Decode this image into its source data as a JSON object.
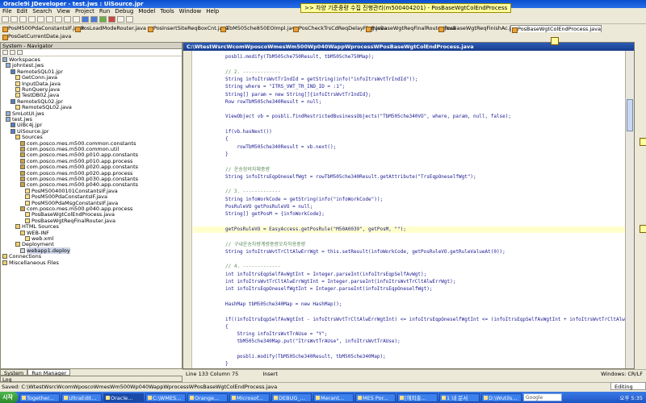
{
  "window": {
    "title": "Oracle9i JDeveloper - test.jws : UiSource.jpr"
  },
  "tooltip": ">> 차양 기준중량 수집 진행관리(m500404201) - PosBaseWgtColEndProcess",
  "menu": [
    "File",
    "Edit",
    "Search",
    "View",
    "Project",
    "Run",
    "Debug",
    "Model",
    "Tools",
    "Window",
    "Help"
  ],
  "file_tabs": {
    "row1": [
      "PosM500PdaConstantsIF.java",
      "PosLoadModeRouter.java",
      "PosInsertSiteReqBoxCnt.java",
      "TbM505che850EOImpl.java",
      "PosCheckTrsCdReqDelayFlag.java",
      "PosBaseWgtReqFinalRouter.java",
      "PosBaseWgtReqFinishAc.java",
      "PosBaseWgtColEndProcess.java"
    ],
    "row2": [
      "PosGetCurrentDate.java"
    ]
  },
  "navigator": {
    "title": "System - Navigator",
    "tree": [
      {
        "label": "Workspaces",
        "icon": "ws"
      },
      {
        "label": "johntest.jws",
        "icon": "ws"
      },
      {
        "label": "RemoteSQL01.jpr",
        "icon": "prj"
      },
      {
        "label": "GetConn.java",
        "icon": "jav"
      },
      {
        "label": "InputData.java",
        "icon": "jav"
      },
      {
        "label": "RunQuery.java",
        "icon": "jav"
      },
      {
        "label": "TestDB02.java",
        "icon": "jav"
      },
      {
        "label": "RemoteSQL02.jpr",
        "icon": "prj"
      },
      {
        "label": "RemoteSQL02.java",
        "icon": "jav"
      },
      {
        "label": "SmLotUI.jws",
        "icon": "ws"
      },
      {
        "label": "test.jws",
        "icon": "ws"
      },
      {
        "label": "UiBc4j.jpr",
        "icon": "prj"
      },
      {
        "label": "UiSource.jpr",
        "icon": "prj"
      },
      {
        "label": "Sources",
        "icon": "fld"
      },
      {
        "label": "com.posco.mes.m500.common.constants",
        "icon": "pkg"
      },
      {
        "label": "com.posco.mes.m500.common.util",
        "icon": "pkg"
      },
      {
        "label": "com.posco.mes.m500.p010.app.constants",
        "icon": "pkg"
      },
      {
        "label": "com.posco.mes.m500.p010.app.process",
        "icon": "pkg"
      },
      {
        "label": "com.posco.mes.m500.p020.app.constants",
        "icon": "pkg"
      },
      {
        "label": "com.posco.mes.m500.p020.app.process",
        "icon": "pkg"
      },
      {
        "label": "com.posco.mes.m500.p030.app.constants",
        "icon": "pkg"
      },
      {
        "label": "com.posco.mes.m500.p040.app.constants",
        "icon": "pkg"
      },
      {
        "label": "PosM500400101ConstantsIF.java",
        "icon": "jav"
      },
      {
        "label": "PosM500PdaConstantsIF.java",
        "icon": "jav"
      },
      {
        "label": "PosM500PdaMsgConstantsIF.java",
        "icon": "jav"
      },
      {
        "label": "com.posco.mes.m500.p040.app.process",
        "icon": "pkg"
      },
      {
        "label": "PosBaseWgtColEndProcess.java",
        "icon": "jav"
      },
      {
        "label": "PosBaseWgtReqFinalRouter.java",
        "icon": "jav"
      },
      {
        "label": "HTML Sources",
        "icon": "fld"
      },
      {
        "label": "WEB-INF",
        "icon": "fld"
      },
      {
        "label": "web.xml",
        "icon": "jav"
      },
      {
        "label": "Deployment",
        "icon": "fld"
      },
      {
        "label": "webapp1.deploy",
        "icon": "jav"
      },
      {
        "label": "Connections",
        "icon": "fld"
      },
      {
        "label": "Miscellaneous Files",
        "icon": "fld"
      }
    ],
    "tabs": [
      "System",
      "Run Manager"
    ],
    "log_label": "Log"
  },
  "editor": {
    "title": "C:\\WtestWsrcWcomWposcoWmesWm500Wp040WappWprocessWPosBaseWgtColEndProcess.java",
    "lines": [
      {
        "t": "posbli.modify(TbM505che750Result, tbM505che750Map);",
        "c": ""
      },
      {
        "t": "",
        "c": ""
      },
      {
        "t": "// 2. -------------",
        "c": "cm"
      },
      {
        "t": "String infoItrsWvtTrIndId = getString(info(\"infoItrsWvtTrIndId\"));",
        "c": ""
      },
      {
        "t": "String where = \"ITRS_VWT_TR_IND_ID = :1\";",
        "c": ""
      },
      {
        "t": "String[] param = new String[]{infoItrsWvtTrIndId};",
        "c": ""
      },
      {
        "t": "Row rowTbM505che340Result = null;",
        "c": ""
      },
      {
        "t": "",
        "c": ""
      },
      {
        "t": "ViewObject vb = posbli.findRestrictedBusinessObjects(\"TbM505che340VO\", where, param, null, false);",
        "c": ""
      },
      {
        "t": "",
        "c": ""
      },
      {
        "t": "if(vb.hasNext())",
        "c": ""
      },
      {
        "t": "{",
        "c": ""
      },
      {
        "t": "    rowTbM505che340Result = vb.next();",
        "c": ""
      },
      {
        "t": "}",
        "c": ""
      },
      {
        "t": "",
        "c": ""
      },
      {
        "t": "// 운송장비자체중량",
        "c": "cm"
      },
      {
        "t": "String infoItrsEqpOneselfWgt = rowTbM505che340Result.getAttribute(\"TrsEqpOneselfWgt\");",
        "c": ""
      },
      {
        "t": "",
        "c": ""
      },
      {
        "t": "// 3. -------------",
        "c": "cm"
      },
      {
        "t": "String infoWorkCode = getString(info(\"infoWorkCode\"));",
        "c": ""
      },
      {
        "t": "PosRuleVO getPosRuleVO = null;",
        "c": ""
      },
      {
        "t": "String[] getPosM = {infoWorkCode};",
        "c": ""
      },
      {
        "t": "",
        "c": ""
      },
      {
        "t": "getPosRuleVO = EasyAccess.getPosRule(\"M50A0039\", getPosM, \"\");",
        "c": "hl"
      },
      {
        "t": "",
        "c": ""
      },
      {
        "t": "// 구내운송차량계량중량오차허용중량",
        "c": "cm"
      },
      {
        "t": "String infoItrsWvtTrCltAlwErrWgt = this.setResult(infoWorkCode, getPosRuleVO.getRuleValueAt(0));",
        "c": ""
      },
      {
        "t": "",
        "c": ""
      },
      {
        "t": "// 4. -------------",
        "c": "cm"
      },
      {
        "t": "int infoItrsEqpSelfAvWgtInt = Integer.parseInt(infoItrsEqpSelfAvWgt);",
        "c": ""
      },
      {
        "t": "int infoItrsWvtTrCltAlwErrWgtInt = Integer.parseInt(infoItrsWvtTrCltAlwErrWgt);",
        "c": ""
      },
      {
        "t": "int infoItrsEqpOneselfWgtInt = Integer.parseInt(infoItrsEqpOneselfWgt);",
        "c": ""
      },
      {
        "t": "",
        "c": ""
      },
      {
        "t": "HashMap tbM505che340Map = new HashMap();",
        "c": ""
      },
      {
        "t": "",
        "c": ""
      },
      {
        "t": "if((infoItrsEqpSelfAvWgtInt - infoItrsWvtTrCltAlwErrWgtInt) <= infoItrsEqpOneselfWgtInt <= (infoItrsEqpSelfAvWgtInt + infoItrsWvtTrCltAlwErrWgtInt))",
        "c": ""
      },
      {
        "t": "{",
        "c": ""
      },
      {
        "t": "    String infoItrsWvtTrAUse = \"Y\";",
        "c": ""
      },
      {
        "t": "    tbM505che340Map.put(\"ItrsWvtTrAUse\", infoItrsWvtTrAUse);",
        "c": ""
      },
      {
        "t": "",
        "c": ""
      },
      {
        "t": "    posbli.modify(TbM505che340Result, tbM505che340Map);",
        "c": ""
      },
      {
        "t": "}",
        "c": ""
      }
    ]
  },
  "status": {
    "position": "Line 133 Column 75",
    "mode": "Insert",
    "encoding": "Windows: CR/LF"
  },
  "pathbar": "Saved: C:\\WtestWsrcWcomWposcoWmesWm500Wp040WappWprocessWPosBaseWgtColEndProcess.java",
  "editing_label": "Editing",
  "taskbar": {
    "start": "시작",
    "tasks": [
      "Together...",
      "UltraEdit...",
      "Oracle...",
      "C:\\WMES...",
      "Orange...",
      "Microsof...",
      "DEBUG_...",
      "Merant...",
      "MES Por...",
      "[해외출...",
      "1 내 문서",
      "D:\\Wutils..."
    ],
    "active_index": 2,
    "google": "Google",
    "clock": "오후 5:35"
  }
}
